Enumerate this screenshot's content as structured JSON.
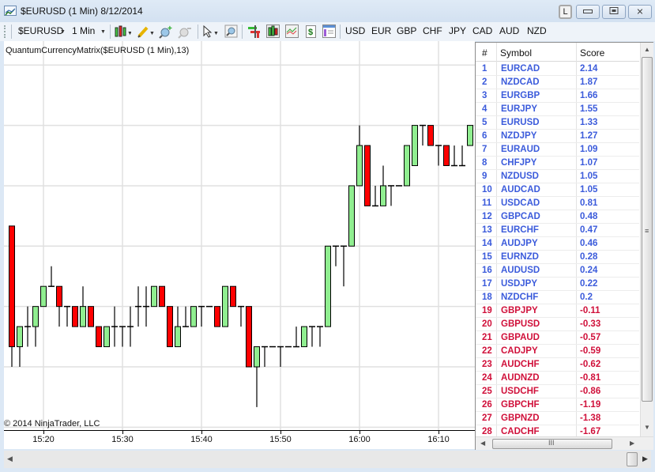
{
  "window": {
    "title": "$EURUSD (1 Min)  8/12/2014",
    "layout_button": "L",
    "minimize_glyph": "▭",
    "maximize_glyph": "▣",
    "close_glyph": "✕"
  },
  "toolbar": {
    "instrument": "$EURUSD",
    "interval": "1 Min",
    "icons": [
      "chart-style-icon",
      "drawing-tool-icon",
      "zoom-in-icon",
      "zoom-out-icon",
      "cursor-icon",
      "zoom-box-icon",
      "order-bars-icon",
      "chart-bars-icon",
      "strategy-chart-icon",
      "dollar-data-icon",
      "properties-icon"
    ],
    "currencies": [
      "USD",
      "EUR",
      "GBP",
      "CHF",
      "JPY",
      "CAD",
      "AUD",
      "NZD"
    ]
  },
  "chart": {
    "indicator_label": "QuantumCurrencyMatrix($EURUSD (1 Min),13)",
    "copyright": "© 2014 NinjaTrader, LLC",
    "colors": {
      "up": "#90ee90",
      "down": "#ff0000",
      "grid": "#e0e0e0",
      "outline": "#000000"
    }
  },
  "chart_data": {
    "type": "candlestick",
    "title": "$EURUSD (1 Min) 8/12/2014",
    "xlabel": "",
    "ylabel": "",
    "price_units": "ticks relative to lowest visible gridline",
    "x_tick_labels": [
      "15:20",
      "15:30",
      "15:40",
      "15:50",
      "16:00",
      "16:10"
    ],
    "ylim": [
      -2.5,
      17
    ],
    "grid": true,
    "candles": [
      {
        "o": 7,
        "h": 7,
        "l": 0,
        "c": 1
      },
      {
        "o": 1,
        "h": 2,
        "l": 0,
        "c": 2
      },
      {
        "o": 2,
        "h": 3,
        "l": 1,
        "c": 2
      },
      {
        "o": 2,
        "h": 3,
        "l": 1,
        "c": 3
      },
      {
        "o": 3,
        "h": 4,
        "l": 3,
        "c": 4
      },
      {
        "o": 4,
        "h": 5,
        "l": 4,
        "c": 4
      },
      {
        "o": 4,
        "h": 4,
        "l": 2,
        "c": 3
      },
      {
        "o": 3,
        "h": 3,
        "l": 2,
        "c": 3
      },
      {
        "o": 3,
        "h": 3,
        "l": 2,
        "c": 2
      },
      {
        "o": 2,
        "h": 4,
        "l": 2,
        "c": 3
      },
      {
        "o": 3,
        "h": 3,
        "l": 2,
        "c": 2
      },
      {
        "o": 2,
        "h": 2,
        "l": 1,
        "c": 1
      },
      {
        "o": 1,
        "h": 2,
        "l": 1,
        "c": 2
      },
      {
        "o": 2,
        "h": 3,
        "l": 1,
        "c": 2
      },
      {
        "o": 2,
        "h": 2,
        "l": 1,
        "c": 2
      },
      {
        "o": 2,
        "h": 3,
        "l": 1,
        "c": 2
      },
      {
        "o": 3,
        "h": 4,
        "l": 2,
        "c": 3
      },
      {
        "o": 3,
        "h": 4,
        "l": 2,
        "c": 3
      },
      {
        "o": 3,
        "h": 4,
        "l": 3,
        "c": 4
      },
      {
        "o": 4,
        "h": 4,
        "l": 3,
        "c": 3
      },
      {
        "o": 3,
        "h": 3,
        "l": 1,
        "c": 1
      },
      {
        "o": 1,
        "h": 3,
        "l": 1,
        "c": 2
      },
      {
        "o": 2,
        "h": 3,
        "l": 2,
        "c": 2
      },
      {
        "o": 2,
        "h": 3,
        "l": 2,
        "c": 3
      },
      {
        "o": 3,
        "h": 3,
        "l": 2,
        "c": 3
      },
      {
        "o": 3,
        "h": 3,
        "l": 3,
        "c": 3
      },
      {
        "o": 3,
        "h": 3,
        "l": 2,
        "c": 2
      },
      {
        "o": 2,
        "h": 4,
        "l": 2,
        "c": 4
      },
      {
        "o": 4,
        "h": 4,
        "l": 3,
        "c": 3
      },
      {
        "o": 3,
        "h": 3,
        "l": 2,
        "c": 3
      },
      {
        "o": 3,
        "h": 3,
        "l": 0,
        "c": 0
      },
      {
        "o": 0,
        "h": 1,
        "l": -2,
        "c": 1
      },
      {
        "o": 1,
        "h": 1,
        "l": 0,
        "c": 1
      },
      {
        "o": 1,
        "h": 1,
        "l": 1,
        "c": 1
      },
      {
        "o": 1,
        "h": 1,
        "l": 0,
        "c": 1
      },
      {
        "o": 1,
        "h": 1,
        "l": 1,
        "c": 1
      },
      {
        "o": 1,
        "h": 2,
        "l": 1,
        "c": 1
      },
      {
        "o": 1,
        "h": 2,
        "l": 1,
        "c": 2
      },
      {
        "o": 2,
        "h": 2,
        "l": 1,
        "c": 2
      },
      {
        "o": 2,
        "h": 2,
        "l": 1,
        "c": 2
      },
      {
        "o": 2,
        "h": 6,
        "l": 2,
        "c": 6
      },
      {
        "o": 6,
        "h": 6,
        "l": 5,
        "c": 6
      },
      {
        "o": 6,
        "h": 6,
        "l": 4,
        "c": 6
      },
      {
        "o": 6,
        "h": 9,
        "l": 6,
        "c": 9
      },
      {
        "o": 9,
        "h": 12,
        "l": 9,
        "c": 11
      },
      {
        "o": 11,
        "h": 11,
        "l": 8,
        "c": 8
      },
      {
        "o": 8,
        "h": 9,
        "l": 8,
        "c": 8
      },
      {
        "o": 8,
        "h": 10,
        "l": 8,
        "c": 9
      },
      {
        "o": 9,
        "h": 9,
        "l": 8,
        "c": 9
      },
      {
        "o": 9,
        "h": 9,
        "l": 9,
        "c": 9
      },
      {
        "o": 9,
        "h": 11,
        "l": 9,
        "c": 11
      },
      {
        "o": 10,
        "h": 12,
        "l": 10,
        "c": 12
      },
      {
        "o": 12,
        "h": 12,
        "l": 11,
        "c": 12
      },
      {
        "o": 12,
        "h": 12,
        "l": 11,
        "c": 11
      },
      {
        "o": 11,
        "h": 11,
        "l": 10,
        "c": 11
      },
      {
        "o": 11,
        "h": 11,
        "l": 10,
        "c": 10
      },
      {
        "o": 10,
        "h": 11,
        "l": 10,
        "c": 10
      },
      {
        "o": 10,
        "h": 11,
        "l": 10,
        "c": 10
      },
      {
        "o": 11,
        "h": 12,
        "l": 11,
        "c": 12
      }
    ]
  },
  "matrix": {
    "headers": {
      "rank": "#",
      "symbol": "Symbol",
      "score": "Score"
    },
    "colors": {
      "positive": "#3b5bdb",
      "negative": "#d0103a"
    },
    "rows": [
      {
        "rank": "1",
        "symbol": "EURCAD",
        "score": "2.14"
      },
      {
        "rank": "2",
        "symbol": "NZDCAD",
        "score": "1.87"
      },
      {
        "rank": "3",
        "symbol": "EURGBP",
        "score": "1.66"
      },
      {
        "rank": "4",
        "symbol": "EURJPY",
        "score": "1.55"
      },
      {
        "rank": "5",
        "symbol": "EURUSD",
        "score": "1.33"
      },
      {
        "rank": "6",
        "symbol": "NZDJPY",
        "score": "1.27"
      },
      {
        "rank": "7",
        "symbol": "EURAUD",
        "score": "1.09"
      },
      {
        "rank": "8",
        "symbol": "CHFJPY",
        "score": "1.07"
      },
      {
        "rank": "9",
        "symbol": "NZDUSD",
        "score": "1.05"
      },
      {
        "rank": "10",
        "symbol": "AUDCAD",
        "score": "1.05"
      },
      {
        "rank": "11",
        "symbol": "USDCAD",
        "score": "0.81"
      },
      {
        "rank": "12",
        "symbol": "GBPCAD",
        "score": "0.48"
      },
      {
        "rank": "13",
        "symbol": "EURCHF",
        "score": "0.47"
      },
      {
        "rank": "14",
        "symbol": "AUDJPY",
        "score": "0.46"
      },
      {
        "rank": "15",
        "symbol": "EURNZD",
        "score": "0.28"
      },
      {
        "rank": "16",
        "symbol": "AUDUSD",
        "score": "0.24"
      },
      {
        "rank": "17",
        "symbol": "USDJPY",
        "score": "0.22"
      },
      {
        "rank": "18",
        "symbol": "NZDCHF",
        "score": "0.2"
      },
      {
        "rank": "19",
        "symbol": "GBPJPY",
        "score": "-0.11"
      },
      {
        "rank": "20",
        "symbol": "GBPUSD",
        "score": "-0.33"
      },
      {
        "rank": "21",
        "symbol": "GBPAUD",
        "score": "-0.57"
      },
      {
        "rank": "22",
        "symbol": "CADJPY",
        "score": "-0.59"
      },
      {
        "rank": "23",
        "symbol": "AUDCHF",
        "score": "-0.62"
      },
      {
        "rank": "24",
        "symbol": "AUDNZD",
        "score": "-0.81"
      },
      {
        "rank": "25",
        "symbol": "USDCHF",
        "score": "-0.86"
      },
      {
        "rank": "26",
        "symbol": "GBPCHF",
        "score": "-1.19"
      },
      {
        "rank": "27",
        "symbol": "GBPNZD",
        "score": "-1.38"
      },
      {
        "rank": "28",
        "symbol": "CADCHF",
        "score": "-1.67"
      }
    ]
  }
}
